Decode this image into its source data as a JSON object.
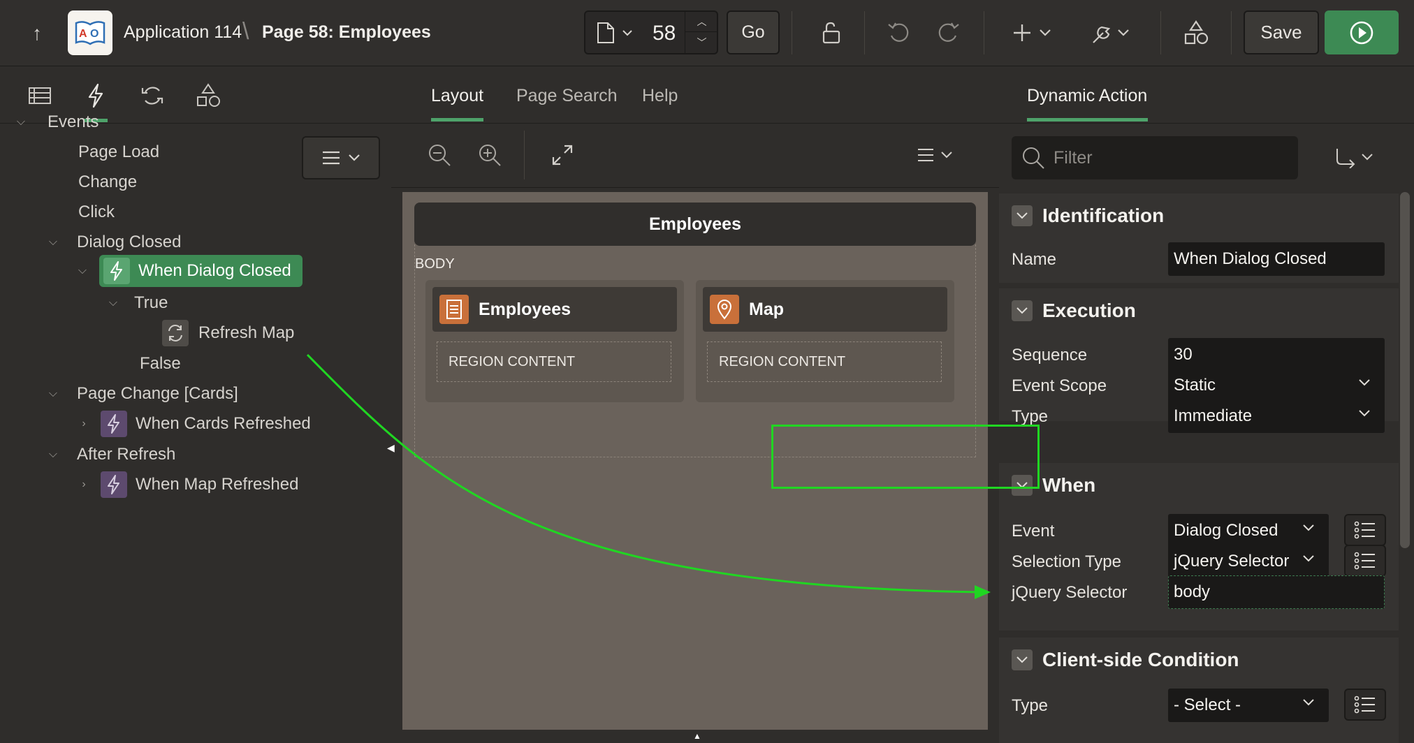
{
  "topbar": {
    "app_name": "Application 114",
    "separator": "\\",
    "page_name": "Page 58: Employees",
    "page_number": "58",
    "go_label": "Go",
    "save_label": "Save"
  },
  "left": {
    "menu_label": "",
    "tree": {
      "events": "Events",
      "page_load": "Page Load",
      "change": "Change",
      "click": "Click",
      "dialog_closed": "Dialog Closed",
      "when_dialog_closed": "When Dialog Closed",
      "true": "True",
      "refresh_map": "Refresh Map",
      "false": "False",
      "page_change_cards": "Page Change [Cards]",
      "when_cards_refreshed": "When Cards Refreshed",
      "after_refresh": "After Refresh",
      "when_map_refreshed": "When Map Refreshed"
    }
  },
  "center": {
    "tabs": [
      "Layout",
      "Page Search",
      "Help"
    ],
    "page_header": "Employees",
    "body_label": "BODY",
    "regions": [
      {
        "title": "Employees",
        "content": "REGION CONTENT"
      },
      {
        "title": "Map",
        "content": "REGION CONTENT"
      }
    ]
  },
  "right": {
    "tab": "Dynamic Action",
    "filter_placeholder": "Filter",
    "identification": {
      "title": "Identification",
      "name_label": "Name",
      "name_value": "When Dialog Closed"
    },
    "execution": {
      "title": "Execution",
      "sequence_label": "Sequence",
      "sequence_value": "30",
      "event_scope_label": "Event Scope",
      "event_scope_value": "Static",
      "type_label": "Type",
      "type_value": "Immediate"
    },
    "when": {
      "title": "When",
      "event_label": "Event",
      "event_value": "Dialog Closed",
      "selection_type_label": "Selection Type",
      "selection_type_value": "jQuery Selector",
      "jquery_selector_label": "jQuery Selector",
      "jquery_selector_value": "body"
    },
    "client_condition": {
      "title": "Client-side Condition",
      "type_label": "Type",
      "type_value": "- Select -"
    }
  },
  "colors": {
    "accent_green": "#3d8a54",
    "annotation_green": "#20d622",
    "region_icon_orange": "#c9703a"
  }
}
